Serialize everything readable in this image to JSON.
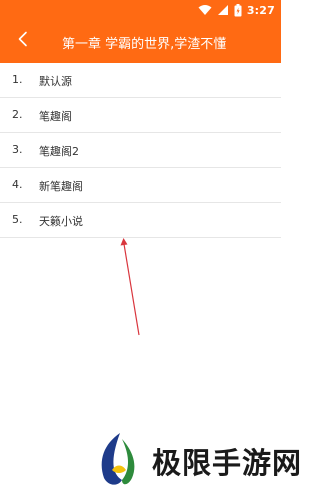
{
  "status_bar": {
    "time": "3:27"
  },
  "app_bar": {
    "title": "第一章 学霸的世界,学渣不懂",
    "color": "#ff6a13"
  },
  "sources": [
    {
      "num": "1.",
      "label": "默认源"
    },
    {
      "num": "2.",
      "label": "笔趣阁"
    },
    {
      "num": "3.",
      "label": "笔趣阁2"
    },
    {
      "num": "4.",
      "label": "新笔趣阁"
    },
    {
      "num": "5.",
      "label": "天籁小说"
    }
  ],
  "watermark": {
    "text": "极限手游网"
  }
}
